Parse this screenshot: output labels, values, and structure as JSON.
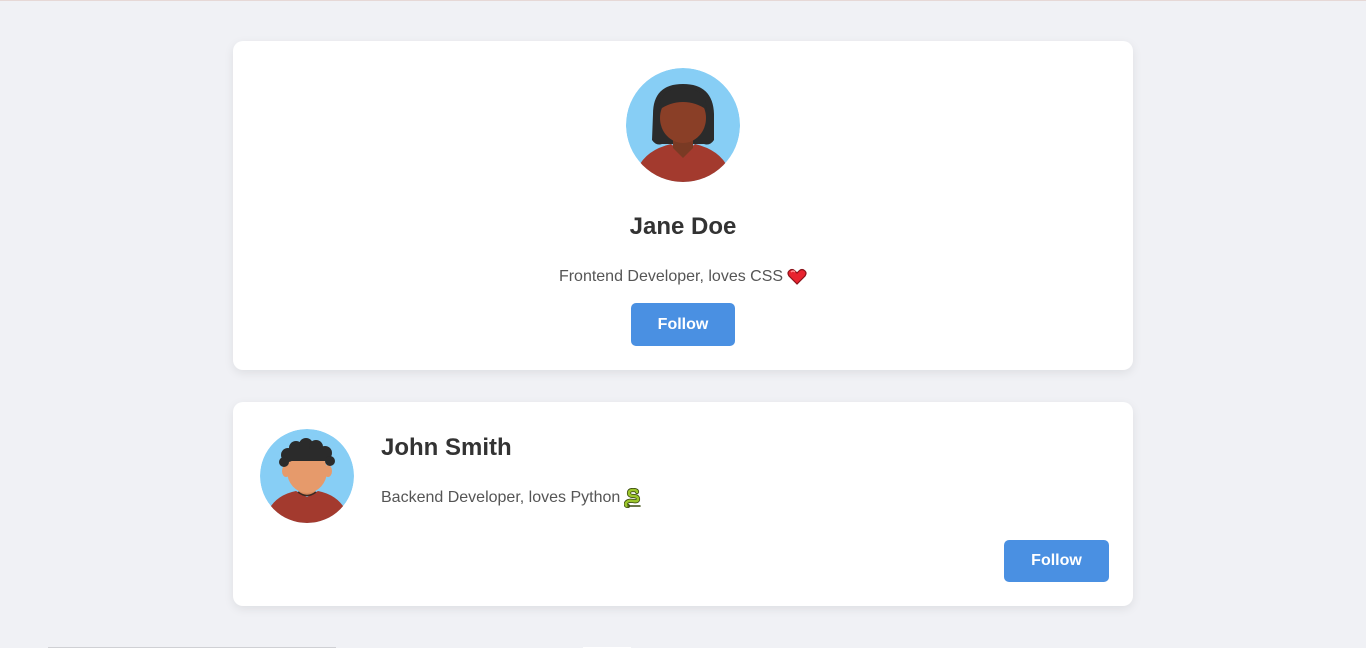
{
  "profiles": [
    {
      "name": "Jane Doe",
      "bio": "Frontend Developer, loves CSS",
      "bio_emoji_icon": "heart-icon",
      "follow_label": "Follow",
      "avatar_icon": "female-avatar-icon"
    },
    {
      "name": "John Smith",
      "bio": "Backend Developer, loves Python",
      "bio_emoji_icon": "snake-icon",
      "follow_label": "Follow",
      "avatar_icon": "male-avatar-icon"
    }
  ],
  "colors": {
    "page_background": "#f0f1f5",
    "card_background": "#ffffff",
    "accent": "#4a90e2",
    "avatar_background": "#87cef5",
    "shirt": "#a33a2e"
  }
}
